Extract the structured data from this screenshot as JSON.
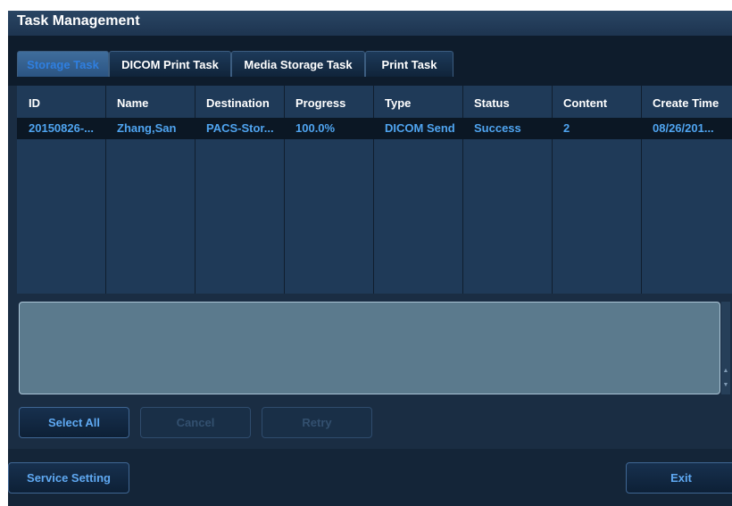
{
  "window": {
    "title": "Task Management"
  },
  "tabs": [
    {
      "label": "Storage Task",
      "active": true
    },
    {
      "label": "DICOM Print Task",
      "active": false
    },
    {
      "label": "Media Storage Task",
      "active": false
    },
    {
      "label": "Print Task",
      "active": false
    }
  ],
  "table": {
    "columns": [
      "ID",
      "Name",
      "Destination",
      "Progress",
      "Type",
      "Status",
      "Content",
      "Create Time"
    ],
    "rows": [
      [
        "20150826-...",
        "Zhang,San",
        "PACS-Stor...",
        "100.0%",
        "DICOM Send",
        "Success",
        "2",
        "08/26/201..."
      ]
    ]
  },
  "buttons": {
    "select_all": "Select All",
    "cancel": "Cancel",
    "retry": "Retry",
    "service_setting": "Service Setting",
    "exit": "Exit"
  },
  "colors": {
    "accent": "#2f7fe0",
    "row_text": "#4fa4f0",
    "background": "#1a2d43"
  }
}
